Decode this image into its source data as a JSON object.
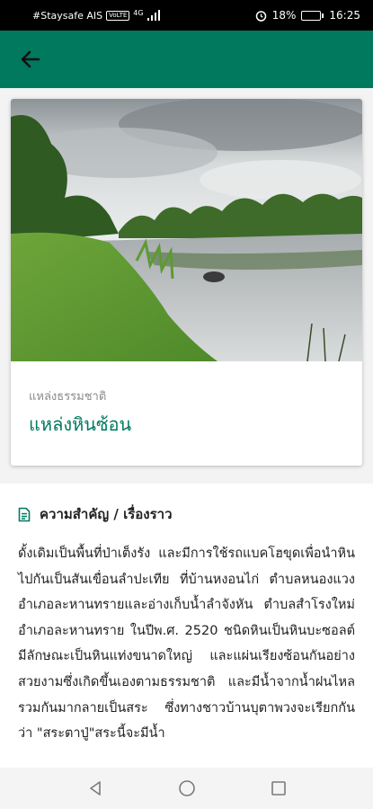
{
  "status_bar": {
    "carrier": "#Staysafe AIS",
    "network_badge": "VoLTE",
    "network_type": "4G",
    "battery_percent": "18%",
    "battery_level": 0.18,
    "time": "16:25"
  },
  "app_bar": {
    "back_icon": "arrow-left",
    "color": "#00795f"
  },
  "place": {
    "category": "แหล่งธรรมชาติ",
    "title": "แหล่งหินซ้อน"
  },
  "section": {
    "icon": "document-icon",
    "title": "ความสำคัญ / เรื่องราว",
    "body": "ดั้งเดิมเป็นพื้นที่ป่าเต็งรัง และมีการใช้รถแบคโฮขุดเพื่อนำหินไปกันเป็นสันเขื่อนลำปะเทีย ที่บ้านหงอนไก่ ตำบลหนองแวง อำเภอละหานทรายและอ่างเก็บน้ำลำจังหัน ตำบลสำโรงใหม่ อำเภอละหานทราย ในปีพ.ศ. 2520 ชนิดหินเป็นหินบะซอลต์ มีลักษณะเป็นหินแท่งขนาดใหญ่ และแผ่นเรียงซ้อนกันอย่างสวยงามซึ่งเกิดขึ้นเองตามธรรมชาติ และมีน้ำจากน้ำฝนไหลรวมกันมากลายเป็นสระ ซึ่งทางชาวบ้านบุตาพวงจะเรียกกันว่า \"สระตาปู่\"สระนี้จะมีน้ำ"
  },
  "nav_bar": {
    "back": "triangle-back-icon",
    "home": "circle-home-icon",
    "recents": "square-recents-icon"
  }
}
